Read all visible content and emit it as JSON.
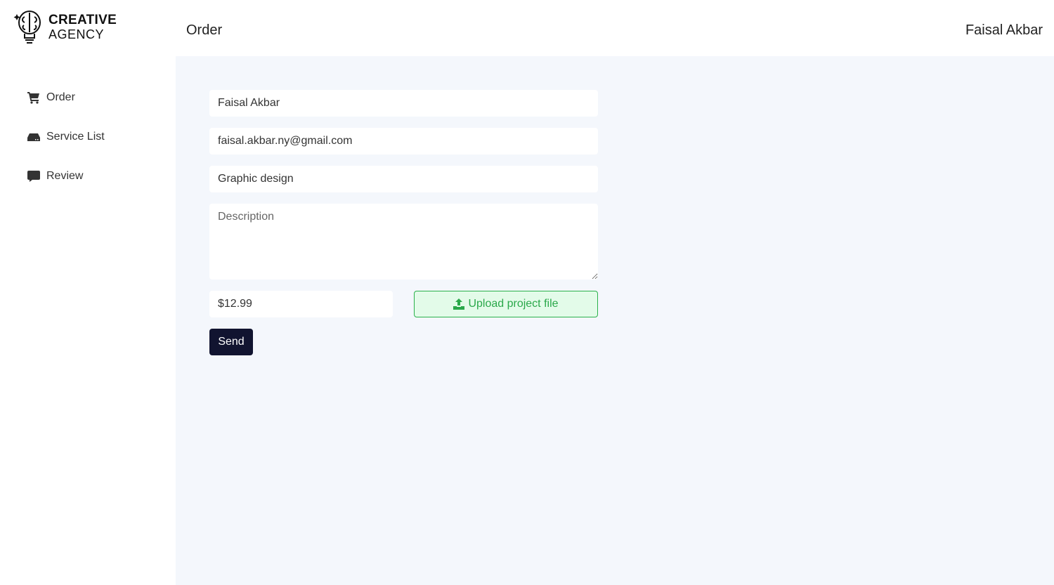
{
  "brand": {
    "line1": "CREATIVE",
    "line2": "AGENCY"
  },
  "header": {
    "title": "Order",
    "user": "Faisal Akbar"
  },
  "sidebar": {
    "items": [
      {
        "label": "Order",
        "icon": "cart-icon"
      },
      {
        "label": "Service List",
        "icon": "hdd-icon"
      },
      {
        "label": "Review",
        "icon": "comment-icon"
      }
    ]
  },
  "form": {
    "name": "Faisal Akbar",
    "email": "faisal.akbar.ny@gmail.com",
    "service": "Graphic design",
    "description_placeholder": "Description",
    "price": "$12.99",
    "upload_label": "Upload project file",
    "send_label": "Send"
  },
  "colors": {
    "accent": "#2ab14a",
    "send": "#111430",
    "background": "#f4f7fc"
  }
}
